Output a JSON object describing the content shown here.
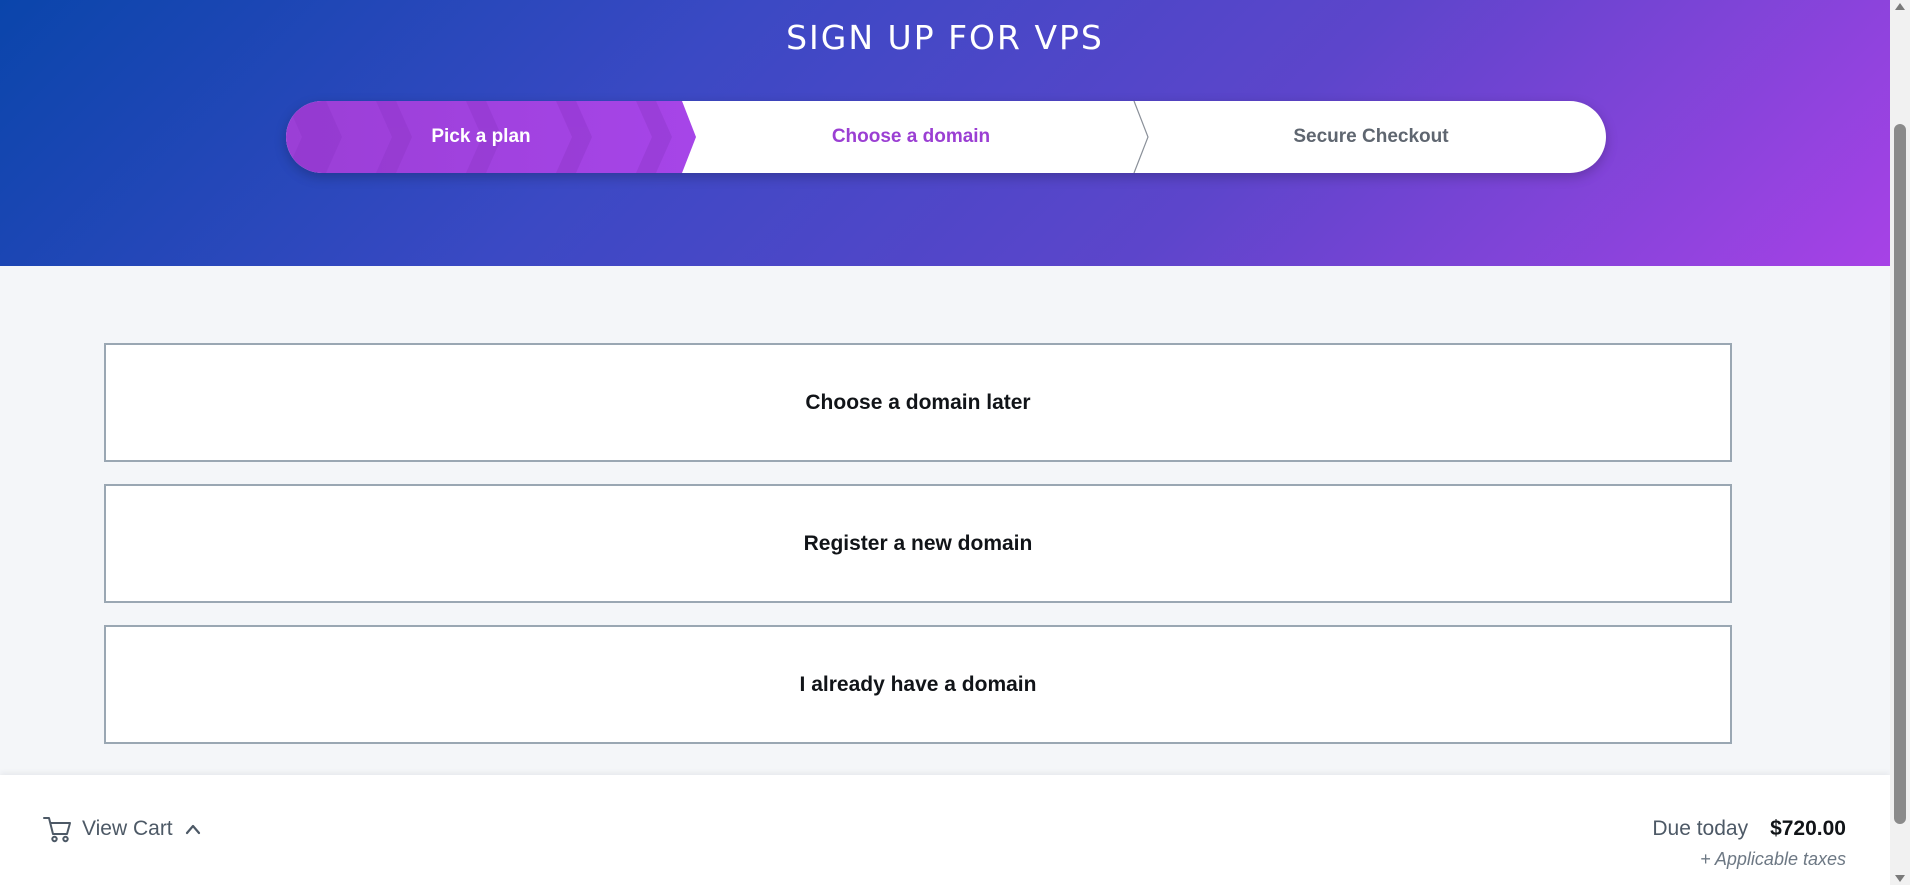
{
  "header": {
    "title": "SIGN UP FOR VPS"
  },
  "stepper": {
    "steps": [
      {
        "label": "Pick a plan",
        "state": "completed"
      },
      {
        "label": "Choose a domain",
        "state": "active"
      },
      {
        "label": "Secure Checkout",
        "state": "upcoming"
      }
    ]
  },
  "options": [
    {
      "label": "Choose a domain later"
    },
    {
      "label": "Register a new domain"
    },
    {
      "label": "I already have a domain"
    }
  ],
  "footer": {
    "view_cart_label": "View Cart",
    "due_label": "Due today",
    "due_amount": "$720.00",
    "taxes_note": "+ Applicable taxes"
  },
  "icons": {
    "cart": "cart-icon",
    "chevron": "chevron-up-icon"
  },
  "colors": {
    "accent_purple": "#9b3fd3",
    "hero_start": "#0a45ab",
    "hero_end": "#a742e6"
  }
}
